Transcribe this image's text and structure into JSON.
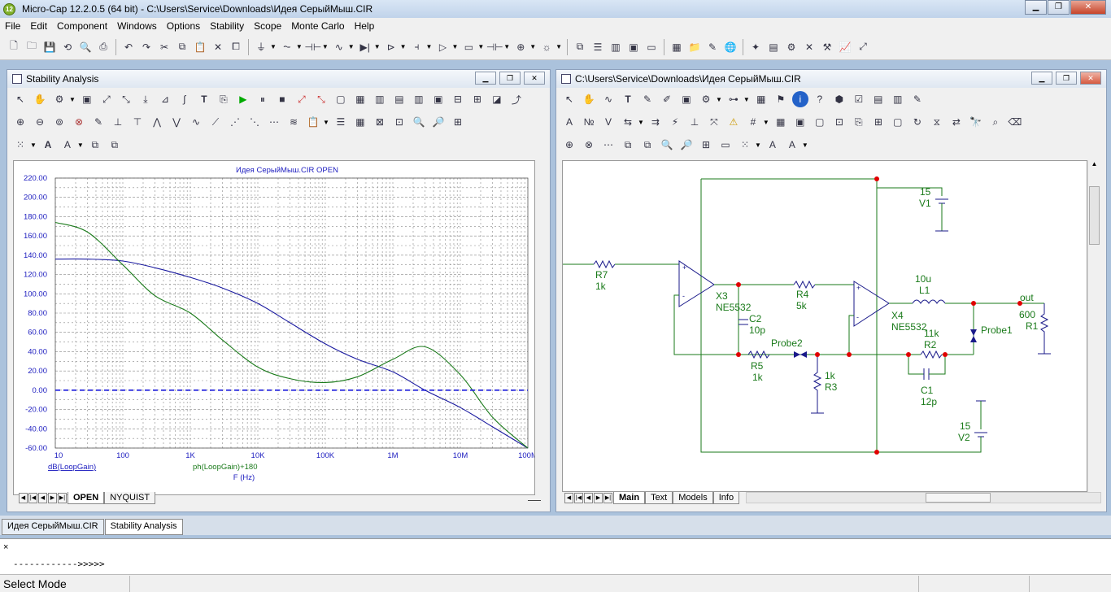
{
  "app": {
    "title": "Micro-Cap 12.2.0.5 (64 bit) - C:\\Users\\Service\\Downloads\\Идея СерыйМыш.CIR"
  },
  "menu": [
    "File",
    "Edit",
    "Component",
    "Windows",
    "Options",
    "Stability",
    "Scope",
    "Monte Carlo",
    "Help"
  ],
  "stability_pane": {
    "title": "Stability Analysis",
    "plot_title": "Идея СерыйМыш.CIR OPEN",
    "tabs": [
      "OPEN",
      "NYQUIST"
    ],
    "active_tab": "OPEN"
  },
  "chart_data": {
    "type": "line",
    "title": "Идея СерыйМыш.CIR OPEN",
    "xlabel": "F (Hz)",
    "x_scale": "log",
    "xlim": [
      10,
      100000000
    ],
    "ylim": [
      -60,
      220
    ],
    "grid": true,
    "x_ticks": [
      "10",
      "100",
      "1K",
      "10K",
      "100K",
      "1M",
      "10M",
      "100M"
    ],
    "y_ticks": [
      "220.00",
      "200.00",
      "180.00",
      "160.00",
      "140.00",
      "120.00",
      "100.00",
      "80.00",
      "60.00",
      "40.00",
      "20.00",
      "0.00",
      "-20.00",
      "-40.00",
      "-60.00"
    ],
    "series": [
      {
        "name": "dB(LoopGain)",
        "color": "#1a1aa0",
        "x": [
          10,
          30,
          100,
          300,
          1000,
          3000,
          10000,
          30000,
          100000,
          300000,
          1000000,
          3000000,
          10000000,
          30000000,
          100000000
        ],
        "y": [
          136,
          136,
          134,
          127,
          117,
          106,
          90,
          70,
          48,
          32,
          19,
          0,
          -18,
          -38,
          -60
        ]
      },
      {
        "name": "ph(LoopGain)+180",
        "color": "#1a7a1a",
        "x": [
          10,
          30,
          100,
          300,
          1000,
          3000,
          10000,
          30000,
          100000,
          300000,
          1000000,
          3000000,
          10000000,
          30000000,
          100000000
        ],
        "y": [
          174,
          164,
          130,
          98,
          80,
          52,
          24,
          12,
          8,
          14,
          32,
          45,
          16,
          -28,
          -60
        ]
      },
      {
        "name": "",
        "color": "#1a1add",
        "style": "dashed",
        "x": [
          10,
          100000000
        ],
        "y": [
          0,
          0
        ]
      }
    ]
  },
  "schematic_pane": {
    "title": "C:\\Users\\Service\\Downloads\\Идея СерыйМыш.CIR",
    "tabs": [
      "Main",
      "Text",
      "Models",
      "Info"
    ],
    "active_tab": "Main",
    "labels": {
      "r7": "R7",
      "r7v": "1k",
      "x3": "X3",
      "x3v": "NE5532",
      "c2": "C2",
      "c2v": "10p",
      "r4": "R4",
      "r4v": "5k",
      "x4": "X4",
      "x4v": "NE5532",
      "l1v": "10u",
      "l1": "L1",
      "out": "out",
      "r1v": "600",
      "r1": "R1",
      "probe1": "Probe1",
      "probe2": "Probe2",
      "r5": "R5",
      "r5v": "1k",
      "r3v": "1k",
      "r3": "R3",
      "r2v": "11k",
      "r2": "R2",
      "c1": "C1",
      "c1v": "12p",
      "v1v": "15",
      "v1": "V1",
      "v2v": "15",
      "v2": "V2"
    }
  },
  "doc_tabs": [
    "Идея СерыйМыш.CIR",
    "Stability Analysis"
  ],
  "output": {
    "close": "×",
    "line": "------------>>>>>"
  },
  "status": {
    "mode": "Select Mode"
  }
}
